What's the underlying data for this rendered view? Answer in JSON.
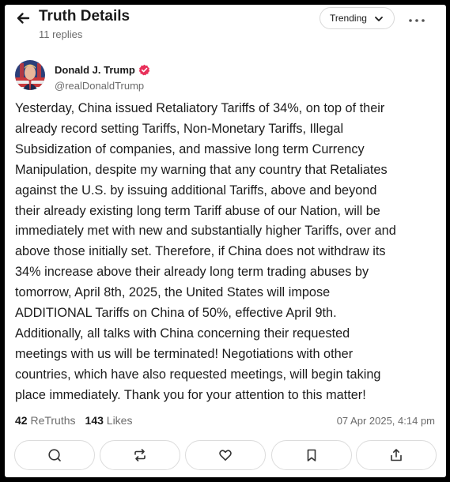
{
  "header": {
    "title": "Truth Details",
    "replies": "11 replies",
    "sort_label": "Trending"
  },
  "post": {
    "author_name": "Donald J. Trump",
    "handle": "@realDonaldTrump",
    "lines": [
      "Yesterday, China issued Retaliatory Tariffs of 34%, on top of their",
      "already record setting Tariffs, Non-Monetary Tariffs, Illegal",
      "Subsidization of companies, and massive long term Currency",
      "Manipulation, despite my warning that any country that Retaliates",
      "against the U.S. by issuing additional Tariffs, above and beyond",
      "their already existing long term Tariff abuse of our Nation, will be",
      "immediately met with new and substantially higher Tariffs, over and",
      "above those initially set. Therefore, if China does not withdraw its",
      "34% increase above their already long term trading abuses by",
      "tomorrow, April 8th, 2025, the United States will impose",
      "ADDITIONAL Tariffs on China of 50%, effective April 9th.",
      "Additionally, all talks with China concerning their requested",
      "meetings with us will be terminated! Negotiations with other",
      "countries, which have also requested meetings, will begin taking",
      "place immediately. Thank you for your attention to this matter!"
    ],
    "retruths_count": "42",
    "retruths_label": "ReTruths",
    "likes_count": "143",
    "likes_label": "Likes",
    "timestamp": "07 Apr 2025, 4:14 pm"
  },
  "icons": {
    "back": "arrow-left-icon",
    "sort": "chevron-down-icon",
    "more": "more-horizontal-icon",
    "verified": "verified-badge-icon",
    "reply": "comment-icon",
    "retruth": "repost-icon",
    "like": "heart-icon",
    "bookmark": "bookmark-icon",
    "share": "share-icon"
  },
  "colors": {
    "verified": "#e8305a",
    "text": "#1a1a1a",
    "muted": "#6b6b6b",
    "border": "#dcdcdc"
  }
}
